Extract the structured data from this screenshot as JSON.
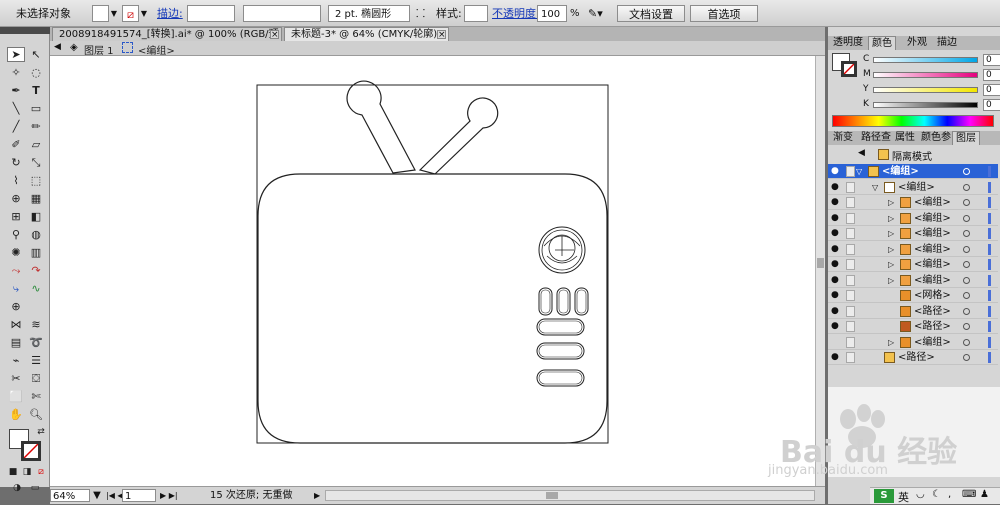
{
  "control_bar": {
    "selection_status": "未选择对象",
    "stroke_label": "描边:",
    "stroke_weight": "2 pt. 椭圆形",
    "style_label": "样式:",
    "opacity_label": "不透明度:",
    "opacity_value": "100",
    "opacity_unit": "%",
    "doc_settings_button": "文档设置",
    "preferences_button": "首选项"
  },
  "doc_tabs": [
    {
      "label": "2008918491574_[转换].ai* @ 100% (RGB/预览)"
    },
    {
      "label": "未标题-3* @ 64% (CMYK/轮廓)"
    }
  ],
  "breadcrumb": {
    "layer": "图层 1",
    "group": "<编组>"
  },
  "color_panel": {
    "tabs": [
      "透明度",
      "颜色",
      "外观",
      "描边"
    ],
    "channels": [
      {
        "label": "C",
        "value": "0",
        "color": "#00a6e6"
      },
      {
        "label": "M",
        "value": "0",
        "color": "#e6007e"
      },
      {
        "label": "Y",
        "value": "0",
        "color": "#f2e600"
      },
      {
        "label": "K",
        "value": "0",
        "color": "#000000"
      }
    ],
    "unit": "%"
  },
  "layers_panel": {
    "tabs": [
      "渐变",
      "路径查",
      "属性",
      "颜色参",
      "图层"
    ],
    "isolation": "隔离模式",
    "rows": [
      {
        "name": "<编组>",
        "level": 0,
        "color": "#f3c24e"
      },
      {
        "name": "<编组>",
        "level": 1,
        "color": "#ffffff"
      },
      {
        "name": "<编组>",
        "level": 2,
        "color": "#f0a040"
      },
      {
        "name": "<编组>",
        "level": 2,
        "color": "#f0a040"
      },
      {
        "name": "<编组>",
        "level": 2,
        "color": "#f0a040"
      },
      {
        "name": "<编组>",
        "level": 2,
        "color": "#f0a040"
      },
      {
        "name": "<编组>",
        "level": 2,
        "color": "#f0a040"
      },
      {
        "name": "<编组>",
        "level": 2,
        "color": "#f0a040"
      },
      {
        "name": "<网格>",
        "level": 2,
        "color": "#e8902a"
      },
      {
        "name": "<路径>",
        "level": 2,
        "color": "#e8902a"
      },
      {
        "name": "<路径>",
        "level": 2,
        "color": "#c05a20"
      },
      {
        "name": "<编组>",
        "level": 2,
        "color": "#e8902a"
      },
      {
        "name": "<路径>",
        "level": 1,
        "color": "#f3c24e"
      }
    ]
  },
  "status_bar": {
    "zoom": "64%",
    "page": "1",
    "undo_status": "15 次还原; 无重做"
  },
  "watermark": {
    "brand": "Bai du 经验",
    "url": "jingyan.baidu.com"
  },
  "taskbar_tray": {
    "ime": "英"
  }
}
